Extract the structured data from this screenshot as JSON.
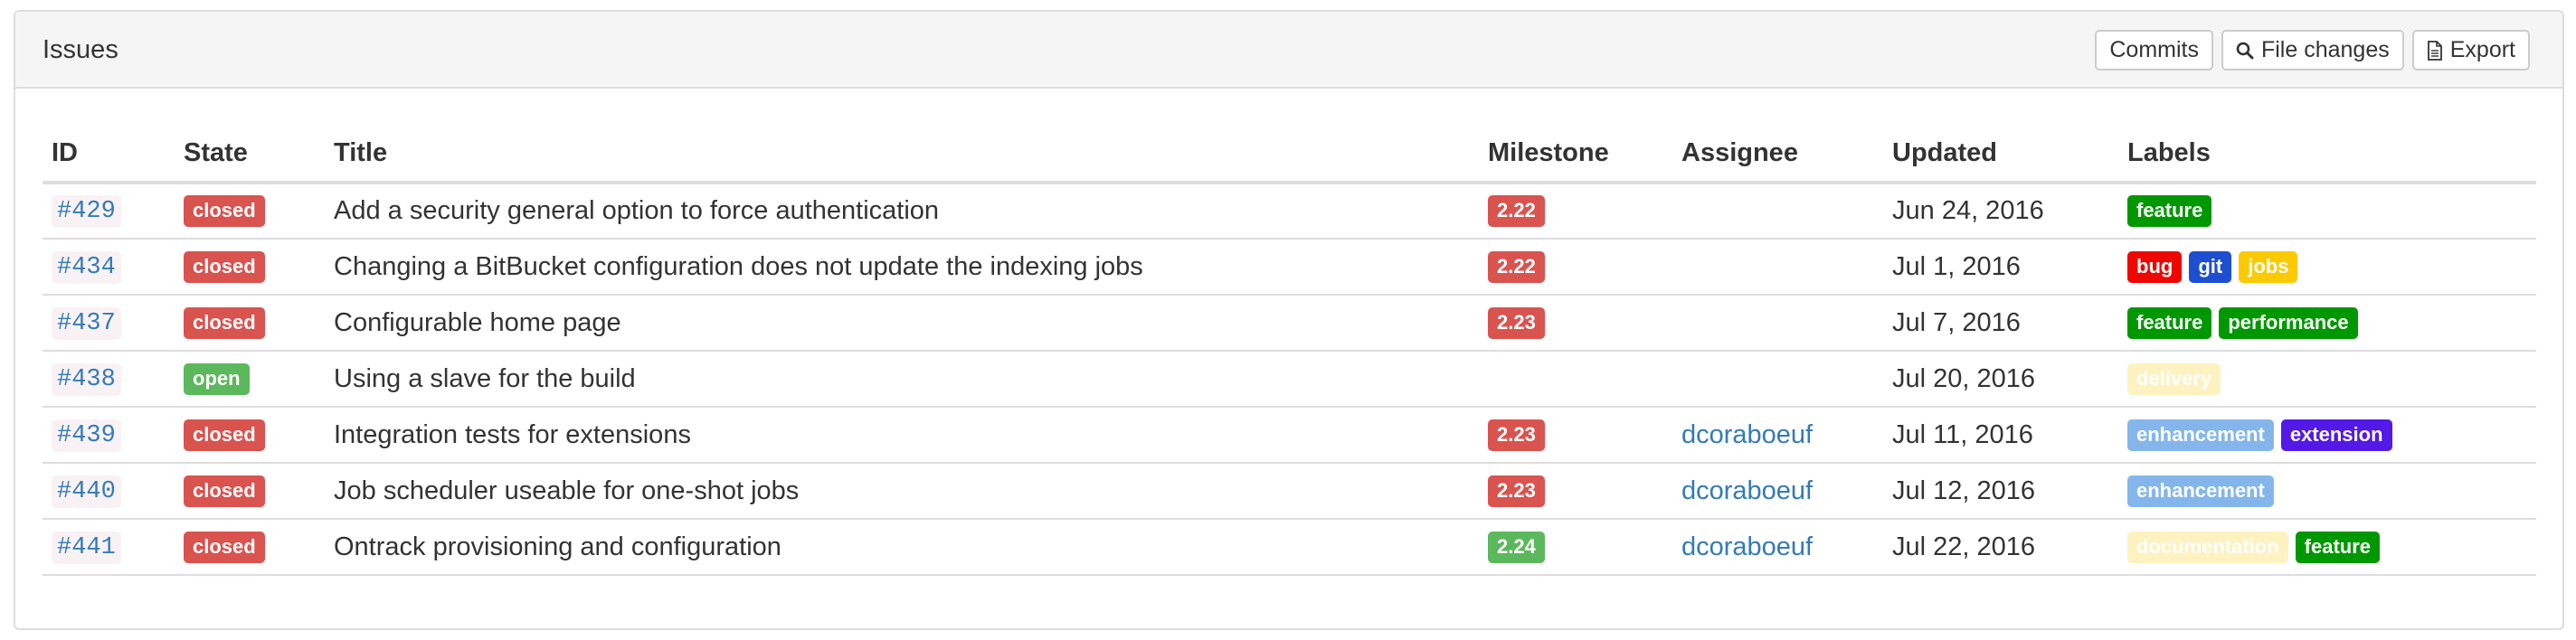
{
  "panel": {
    "title": "Issues"
  },
  "toolbar": {
    "commits_label": "Commits",
    "file_changes_label": "File changes",
    "export_label": "Export"
  },
  "table": {
    "headers": [
      "ID",
      "State",
      "Title",
      "Milestone",
      "Assignee",
      "Updated",
      "Labels"
    ],
    "rows": [
      {
        "id": "#429",
        "state": "closed",
        "title": "Add a security general option to force authentication",
        "milestone": "2.22",
        "milestone_color": "#d9534f",
        "assignee": "",
        "updated": "Jun 24, 2016",
        "labels": [
          {
            "text": "feature",
            "color": "#009800"
          }
        ]
      },
      {
        "id": "#434",
        "state": "closed",
        "title": "Changing a BitBucket configuration does not update the indexing jobs",
        "milestone": "2.22",
        "milestone_color": "#d9534f",
        "assignee": "",
        "updated": "Jul 1, 2016",
        "labels": [
          {
            "text": "bug",
            "color": "#ee0701"
          },
          {
            "text": "git",
            "color": "#1d4fd0"
          },
          {
            "text": "jobs",
            "color": "#fbca04"
          }
        ]
      },
      {
        "id": "#437",
        "state": "closed",
        "title": "Configurable home page",
        "milestone": "2.23",
        "milestone_color": "#d9534f",
        "assignee": "",
        "updated": "Jul 7, 2016",
        "labels": [
          {
            "text": "feature",
            "color": "#009800"
          },
          {
            "text": "performance",
            "color": "#009800"
          }
        ]
      },
      {
        "id": "#438",
        "state": "open",
        "title": "Using a slave for the build",
        "milestone": "",
        "milestone_color": "#d9534f",
        "assignee": "",
        "updated": "Jul 20, 2016",
        "labels": [
          {
            "text": "delivery",
            "color": "#fef2c0"
          }
        ]
      },
      {
        "id": "#439",
        "state": "closed",
        "title": "Integration tests for extensions",
        "milestone": "2.23",
        "milestone_color": "#d9534f",
        "assignee": "dcoraboeuf",
        "updated": "Jul 11, 2016",
        "labels": [
          {
            "text": "enhancement",
            "color": "#84b6eb"
          },
          {
            "text": "extension",
            "color": "#5319e7"
          }
        ]
      },
      {
        "id": "#440",
        "state": "closed",
        "title": "Job scheduler useable for one-shot jobs",
        "milestone": "2.23",
        "milestone_color": "#d9534f",
        "assignee": "dcoraboeuf",
        "updated": "Jul 12, 2016",
        "labels": [
          {
            "text": "enhancement",
            "color": "#84b6eb"
          }
        ]
      },
      {
        "id": "#441",
        "state": "closed",
        "title": "Ontrack provisioning and configuration",
        "milestone": "2.24",
        "milestone_color": "#5cb85c",
        "assignee": "dcoraboeuf",
        "updated": "Jul 22, 2016",
        "labels": [
          {
            "text": "documentation",
            "color": "#fef2c0"
          },
          {
            "text": "feature",
            "color": "#009800"
          }
        ]
      }
    ]
  },
  "colors": {
    "closed": "#d9534f",
    "open": "#5cb85c",
    "link": "#337ab7"
  },
  "icons": {
    "file_changes": "search-icon",
    "export": "document-icon"
  }
}
